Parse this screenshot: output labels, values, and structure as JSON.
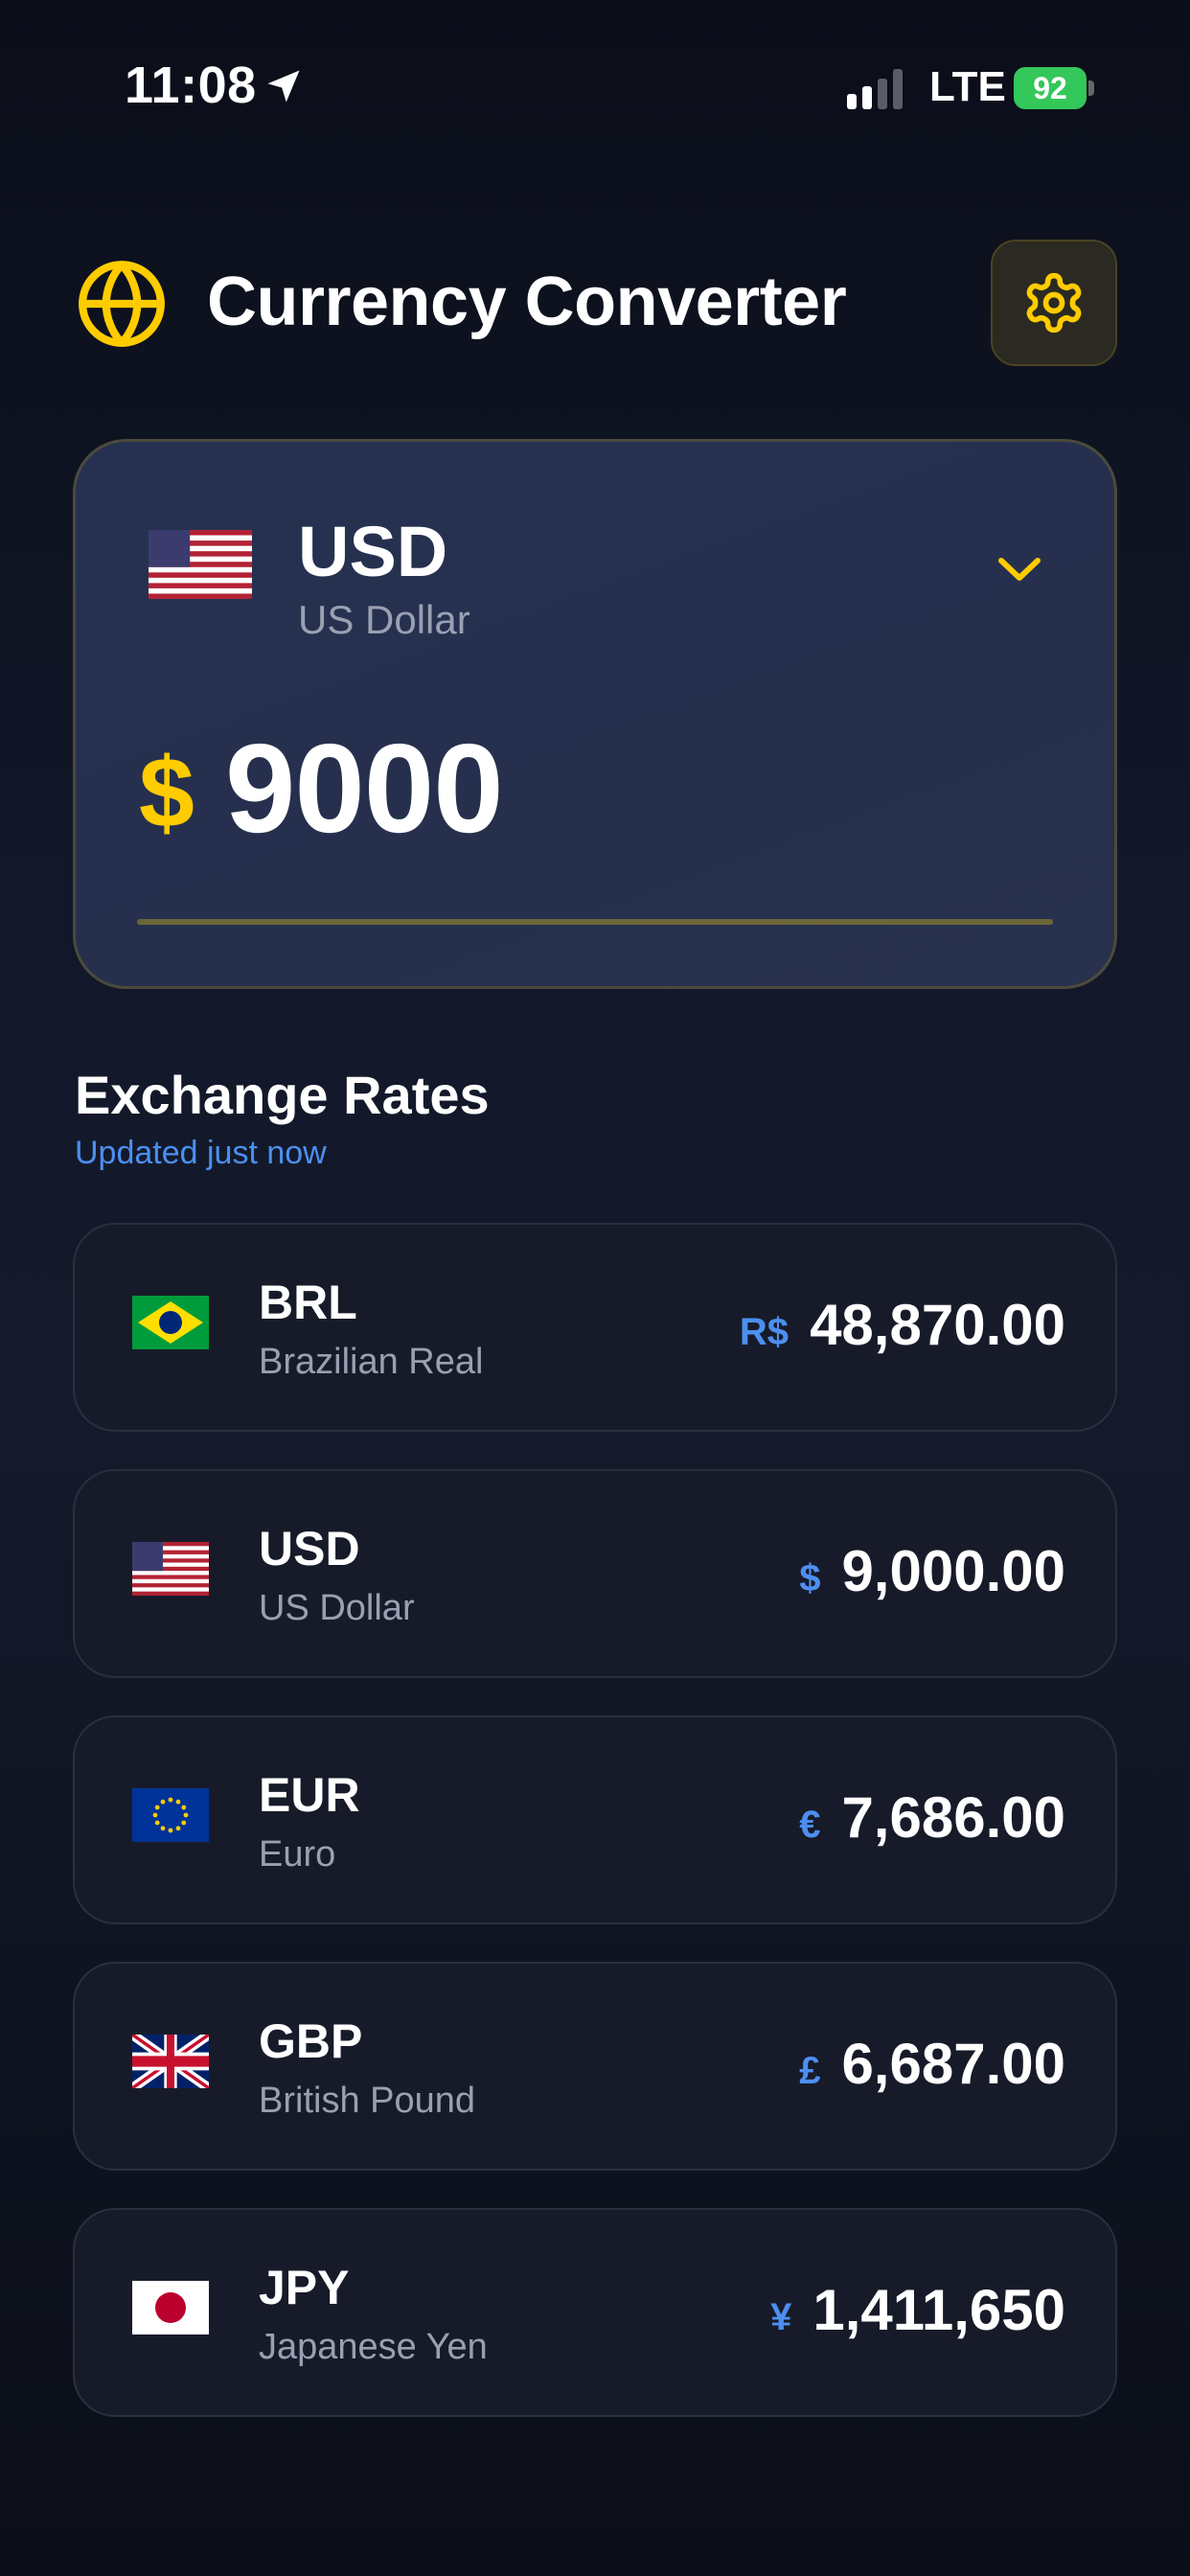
{
  "status_bar": {
    "time": "11:08",
    "network": "LTE",
    "battery": "92"
  },
  "header": {
    "title": "Currency Converter",
    "icons": {
      "app": "globe-icon",
      "settings": "gear-icon"
    }
  },
  "colors": {
    "accent": "#ffcc00",
    "link": "#4c8ff0",
    "battery": "#34c759"
  },
  "converter": {
    "code": "USD",
    "name": "US Dollar",
    "symbol": "$",
    "amount": "9000"
  },
  "rates_section": {
    "title": "Exchange Rates",
    "subtitle": "Updated just now"
  },
  "rates": [
    {
      "code": "BRL",
      "name": "Brazilian Real",
      "symbol": "R$",
      "value": "48,870.00",
      "flag": "brazil-flag-icon"
    },
    {
      "code": "USD",
      "name": "US Dollar",
      "symbol": "$",
      "value": "9,000.00",
      "flag": "us-flag-icon"
    },
    {
      "code": "EUR",
      "name": "Euro",
      "symbol": "€",
      "value": "7,686.00",
      "flag": "eu-flag-icon"
    },
    {
      "code": "GBP",
      "name": "British Pound",
      "symbol": "£",
      "value": "6,687.00",
      "flag": "uk-flag-icon"
    },
    {
      "code": "JPY",
      "name": "Japanese Yen",
      "symbol": "¥",
      "value": "1,411,650",
      "flag": "japan-flag-icon"
    }
  ]
}
